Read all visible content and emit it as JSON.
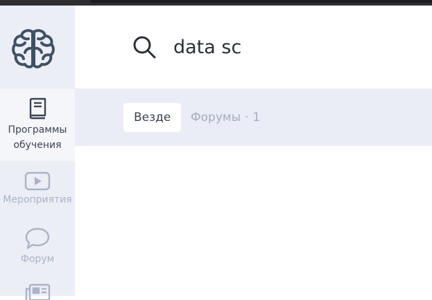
{
  "search": {
    "query": "data sc",
    "icon": "search-icon"
  },
  "sidebar": {
    "logo_icon": "brain-icon",
    "items": [
      {
        "label": "Программы обучения",
        "line1": "Программы",
        "line2": "обучения",
        "icon": "book-icon",
        "active": true
      },
      {
        "label": "Мероприятия",
        "icon": "play-icon",
        "active": false
      },
      {
        "label": "Форум",
        "icon": "speech-bubble-icon",
        "active": false
      },
      {
        "label": "",
        "icon": "newspaper-icon",
        "active": false
      }
    ]
  },
  "filters": {
    "all_label": "Везде",
    "forums_label": "Форумы",
    "forums_count": "1"
  },
  "colors": {
    "sidebar_bg": "#eceef5",
    "filter_bar_bg": "#eaedf6",
    "icon_dark": "#3f5163",
    "icon_muted": "#aab3c7"
  }
}
